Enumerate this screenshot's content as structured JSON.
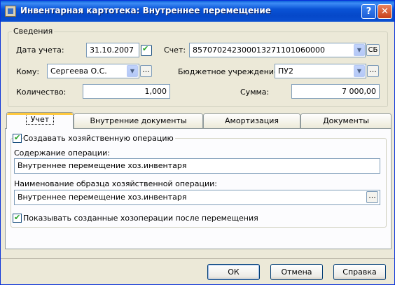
{
  "window": {
    "title": "Инвентарная картотека: Внутреннее перемещение",
    "help_label": "?",
    "close_label": "✕"
  },
  "details": {
    "legend": "Сведения",
    "date_label": "Дата учета:",
    "date_value": "31.10.2007",
    "account_label": "Счет:",
    "account_value": "857070242300013271101060000",
    "account_button": "СБ",
    "to_label": "Кому:",
    "to_value": "Сергеева О.С.",
    "institution_label": "Бюджетное учреждение:",
    "institution_value": "ПУ2",
    "quantity_label": "Количество:",
    "quantity_value": "1,000",
    "sum_label": "Сумма:",
    "sum_value": "7 000,00",
    "ellipsis": "..."
  },
  "tabs": [
    {
      "label": "Учет",
      "active": true
    },
    {
      "label": "Внутренние документы",
      "active": false
    },
    {
      "label": "Амортизация",
      "active": false
    },
    {
      "label": "Документы",
      "active": false
    }
  ],
  "panel": {
    "create_operation_label": "Создавать хозяйственную операцию",
    "create_operation_checked": true,
    "content_label": "Содержание операции:",
    "content_value": "Внутреннее перемещение хоз.инвентаря",
    "template_label": "Наименование образца хозяйственной операции:",
    "template_value": "Внутреннее перемещение хоз.инвентаря",
    "show_created_label": "Показывать созданные хозоперации после перемещения",
    "show_created_checked": true
  },
  "buttons": {
    "ok": "ОК",
    "cancel": "Отмена",
    "help": "Справка"
  },
  "icons": {
    "dropdown": "▼",
    "check": "✔"
  }
}
